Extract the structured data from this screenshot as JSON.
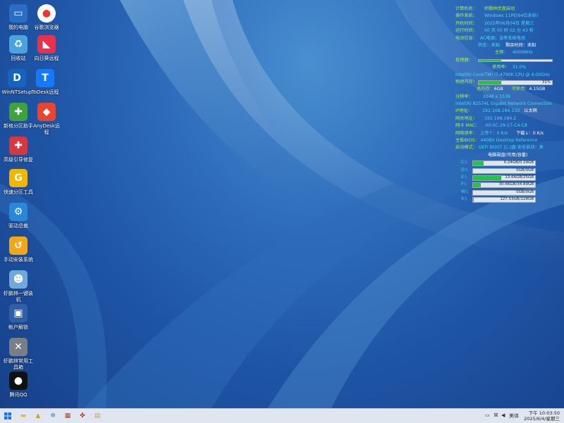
{
  "desktop_icons": [
    {
      "label": "我的电脑",
      "icon": "computer-icon",
      "color": "#2b6cc4",
      "glyph": "▭"
    },
    {
      "label": "谷歌浏览器",
      "icon": "chrome-icon",
      "color": "#ffffff",
      "glyph": "●"
    },
    {
      "label": "回收站",
      "icon": "recycle-bin-icon",
      "color": "#4aa3df",
      "glyph": "♻"
    },
    {
      "label": "向日葵远程",
      "icon": "sunlogin-icon",
      "color": "#e8314f",
      "glyph": "◣"
    },
    {
      "label": "WinNTSetup",
      "icon": "winntsetup-icon",
      "color": "#1565c0",
      "glyph": "D"
    },
    {
      "label": "ToDesk远程",
      "icon": "todesk-icon",
      "color": "#1677ff",
      "glyph": "T"
    },
    {
      "label": "新格分区助手",
      "icon": "partition-assistant-icon",
      "color": "#3da33d",
      "glyph": "✚"
    },
    {
      "label": "AnyDesk远程",
      "icon": "anydesk-icon",
      "color": "#e8442f",
      "glyph": "◆"
    },
    {
      "label": "高级引导修复",
      "icon": "boot-repair-icon",
      "color": "#d9373f",
      "glyph": "✚"
    },
    {
      "label": "快速分区工具",
      "icon": "quick-partition-icon",
      "color": "#f2b600",
      "glyph": "G"
    },
    {
      "label": "驱动总裁",
      "icon": "driver-icon",
      "color": "#2a88d8",
      "glyph": "⚙"
    },
    {
      "label": "手动安装系统",
      "icon": "install-system-icon",
      "color": "#f0a818",
      "glyph": "↺"
    },
    {
      "label": "虾鹏林一键装机",
      "icon": "ghost-icon",
      "color": "#6fa8dc",
      "glyph": "☻"
    },
    {
      "label": "帐户解锁",
      "icon": "account-unlock-icon",
      "color": "#2e5fa8",
      "glyph": "▣"
    },
    {
      "label": "虾鹏林常用工具箱",
      "icon": "toolbox-icon",
      "color": "#7a7f87",
      "glyph": "✕"
    },
    {
      "label": "腾讯QQ",
      "icon": "qq-icon",
      "color": "#111111",
      "glyph": "●"
    }
  ],
  "sysinfo": {
    "computer_name_label": "计算机名：",
    "computer_name": "虾鹏林优盘启动",
    "os_label": "操作系统：",
    "os": "Windows 11PE(64位系统)",
    "boot_time_label": "开机时间：",
    "boot_time": "2025年06月04日 星期三",
    "uptime_label": "运行时间：",
    "uptime": "00 天 00 时 02 分 43 秒",
    "battery_label": "电池信息：",
    "battery": "AC电源；没有系统电池",
    "charge_label": "状态：未知",
    "remaining_label": "剩余时间：未知",
    "freq_label": "主频：",
    "freq": "4000MHz",
    "cpu_label": "处理器：",
    "cpu_usage_label": "使用率：",
    "cpu_usage": "31.0%",
    "cpu_usage_value": 31,
    "cpu_model": "Intel(R) Core(TM) i7-4790K CPU @ 4.00GHz",
    "mem_label": "物理内存：",
    "mem_percent": "31%",
    "mem_usage_value": 31,
    "mem_total_label": "总内存：",
    "mem_total": "6GB",
    "mem_avail_label": "可使用：",
    "mem_avail": "4.15GB",
    "resolution_label": "分辨率：",
    "resolution": "2048 x 1536",
    "nic": "Intel(R) 82574L Gigabit Network Connection",
    "ip_label": "IP地址：",
    "ip": "192.168.184.133",
    "ip_type": "以太网",
    "gateway_label": "网关地址：",
    "gateway": "192.168.184.2",
    "mac_label": "网卡 MAC：",
    "mac": "00-0C-29-17-C4-C8",
    "speed_label": "网络速率：",
    "upload": "上传↑：0 K/s",
    "download": "下载↓：0 K/s",
    "bios_label": "主板BIOS：",
    "bios": "440BX Desktop Reference",
    "bootmode_label": "启动模式：",
    "bootmode": "UEFI BOOT [C:]盘 安全启动：关",
    "disk_title": "电脑磁盘(可用/容量)",
    "disks": [
      {
        "letter": "C:\\",
        "text": "0.24GB/0.29GB",
        "usage": 17
      },
      {
        "letter": "D:\\",
        "text": "0GB/0GB",
        "usage": 0
      },
      {
        "letter": "E:\\",
        "text": "13.66GB/25GB",
        "usage": 45
      },
      {
        "letter": "F:\\",
        "text": "30.66GB/34.89GB",
        "usage": 12
      },
      {
        "letter": "W:\\",
        "text": "0GB/0GB",
        "usage": 0
      },
      {
        "letter": "X:\\",
        "text": "127.53GB/128GB",
        "usage": 1
      }
    ]
  },
  "taskbar": {
    "start_icon": "windows-start-icon",
    "pinned": [
      {
        "name": "file-explorer-icon",
        "glyph": "▬",
        "color": "#f2b33b"
      },
      {
        "name": "lock-icon",
        "glyph": "▲",
        "color": "#e0a020"
      },
      {
        "name": "settings-gear-icon",
        "glyph": "✲",
        "color": "#2b7bd6"
      },
      {
        "name": "screenshot-icon",
        "glyph": "▦",
        "color": "#b04020"
      },
      {
        "name": "tools-icon",
        "glyph": "✤",
        "color": "#c03030"
      },
      {
        "name": "installer-icon",
        "glyph": "▤",
        "color": "#d0a040"
      }
    ],
    "ime": "美体",
    "time": "下午 10:03:50",
    "date": "2025/6/4/星期三"
  }
}
